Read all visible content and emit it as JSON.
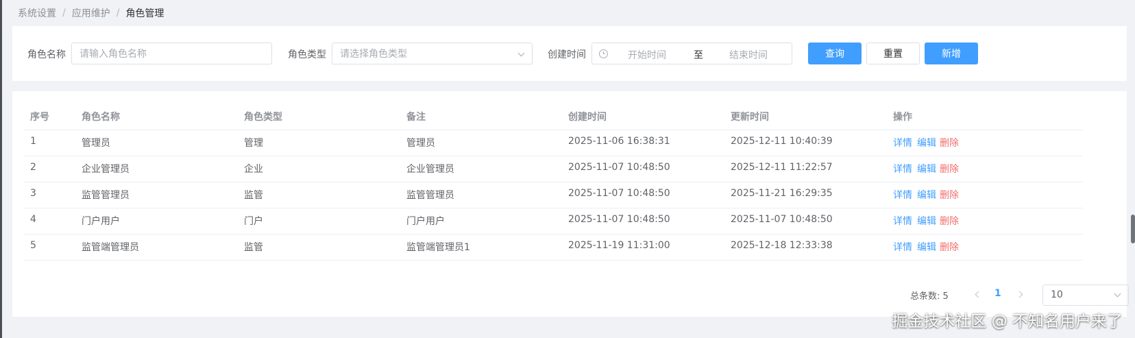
{
  "breadcrumb": [
    "系统设置",
    "应用维护",
    "角色管理"
  ],
  "filters": {
    "role_name_label": "角色名称",
    "role_name_placeholder": "请输入角色名称",
    "role_type_label": "角色类型",
    "role_type_placeholder": "请选择角色类型",
    "created_label": "创建时间",
    "start_placeholder": "开始时间",
    "range_separator": "至",
    "end_placeholder": "结束时间",
    "query_button": "查询",
    "reset_button": "重置",
    "add_button": "新增"
  },
  "table": {
    "columns": [
      "序号",
      "角色名称",
      "角色类型",
      "备注",
      "创建时间",
      "更新时间",
      "操作"
    ],
    "rows": [
      {
        "index": "1",
        "name": "管理员",
        "type": "管理",
        "remark": "管理员",
        "created": "2025-11-06 16:38:31",
        "updated": "2025-12-11 10:40:39"
      },
      {
        "index": "2",
        "name": "企业管理员",
        "type": "企业",
        "remark": "企业管理员",
        "created": "2025-11-07 10:48:50",
        "updated": "2025-12-11 11:22:57"
      },
      {
        "index": "3",
        "name": "监管管理员",
        "type": "监管",
        "remark": "监管管理员",
        "created": "2025-11-07 10:48:50",
        "updated": "2025-11-21 16:29:35"
      },
      {
        "index": "4",
        "name": "门户用户",
        "type": "门户",
        "remark": "门户用户",
        "created": "2025-11-07 10:48:50",
        "updated": "2025-11-07 10:48:50"
      },
      {
        "index": "5",
        "name": "监管端管理员",
        "type": "监管",
        "remark": "监管端管理员1",
        "created": "2025-11-19 11:31:00",
        "updated": "2025-12-18 12:33:38"
      }
    ],
    "actions": {
      "detail": "详情",
      "edit": "编辑",
      "delete": "删除"
    }
  },
  "pagination": {
    "total_label": "总条数:",
    "total": "5",
    "current_page": "1",
    "page_size": "10"
  },
  "watermark": "掘金技术社区 @ 不知名用户来了",
  "colors": {
    "primary": "#409eff",
    "danger": "#f56c6c",
    "background": "#f0f2f5"
  }
}
